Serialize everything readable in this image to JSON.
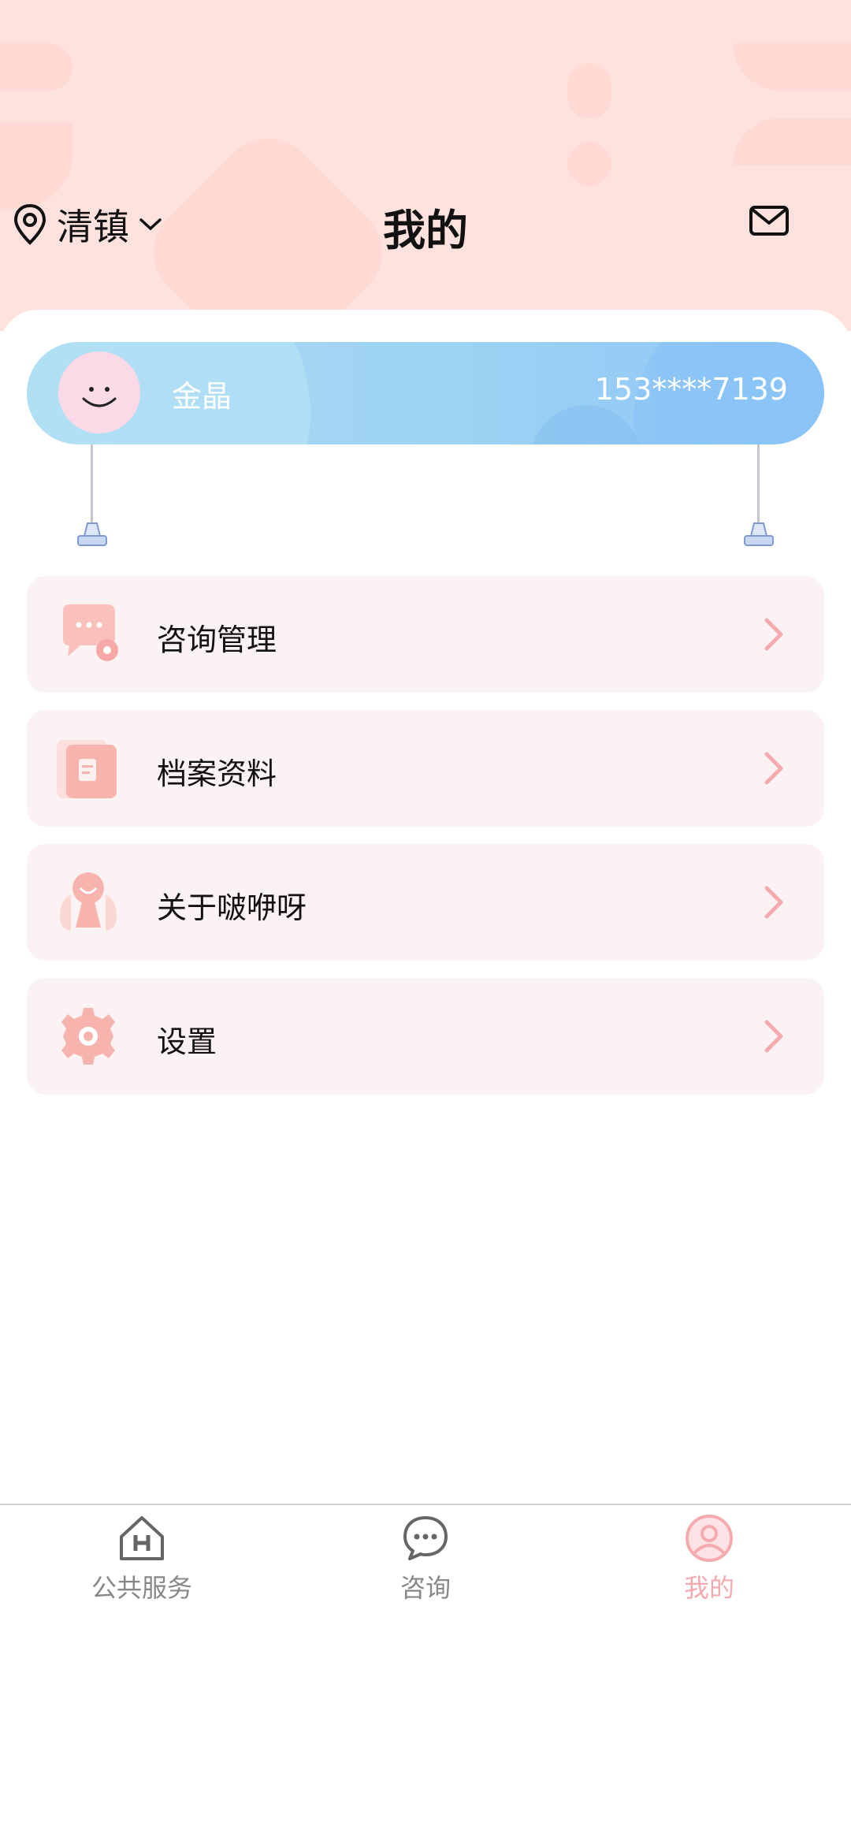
{
  "header": {
    "location": "清镇",
    "title": "我的"
  },
  "profile": {
    "name": "金晶",
    "phone": "153****7139"
  },
  "menu": [
    {
      "label": "咨询管理",
      "icon": "chat-gear-icon"
    },
    {
      "label": "档案资料",
      "icon": "document-icon"
    },
    {
      "label": "关于啵咿呀",
      "icon": "about-icon"
    },
    {
      "label": "设置",
      "icon": "gear-icon"
    }
  ],
  "tabs": [
    {
      "label": "公共服务",
      "icon": "home-icon"
    },
    {
      "label": "咨询",
      "icon": "chat-bubble-icon"
    },
    {
      "label": "我的",
      "icon": "profile-icon",
      "active": true
    }
  ],
  "colors": {
    "header_bg": "#ffe2dd",
    "accent": "#f5aab0",
    "card_gradient_start": "#a9dcf2",
    "card_gradient_end": "#8ec6f7",
    "menu_item_bg": "#fbf3f3"
  }
}
